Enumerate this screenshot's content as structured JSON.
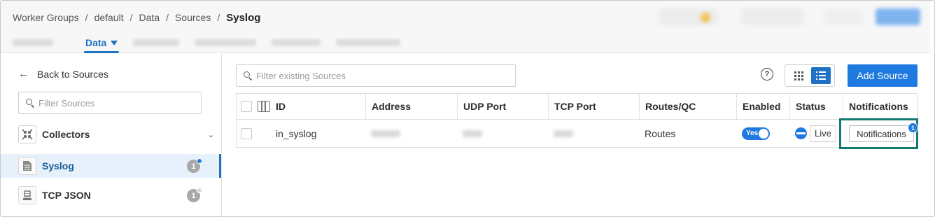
{
  "breadcrumb": {
    "items": [
      "Worker Groups",
      "default",
      "Data",
      "Sources"
    ],
    "separator": "/",
    "current": "Syslog"
  },
  "nav": {
    "active_tab": "Data"
  },
  "sidebar": {
    "back_label": "Back to Sources",
    "search_placeholder": "Filter Sources",
    "group_label": "Collectors",
    "items": [
      {
        "name": "Syslog",
        "count": "1",
        "dot_color": "#1f7ae0"
      },
      {
        "name": "TCP JSON",
        "count": "1",
        "dot_color": "#d9d9d9"
      }
    ]
  },
  "main": {
    "search_placeholder": "Filter existing Sources",
    "help_label": "?",
    "add_button": "Add Source",
    "columns": [
      "ID",
      "Address",
      "UDP Port",
      "TCP Port",
      "Routes/QC",
      "Enabled",
      "Status",
      "Notifications"
    ],
    "rows": [
      {
        "id": "in_syslog",
        "routes": "Routes",
        "enabled_label": "Yes",
        "status_button": "Live",
        "notifications_button": "Notifications",
        "notifications_count": "1"
      }
    ]
  },
  "colors": {
    "accent": "#1f7ae0",
    "highlight_box": "#137a6e"
  }
}
